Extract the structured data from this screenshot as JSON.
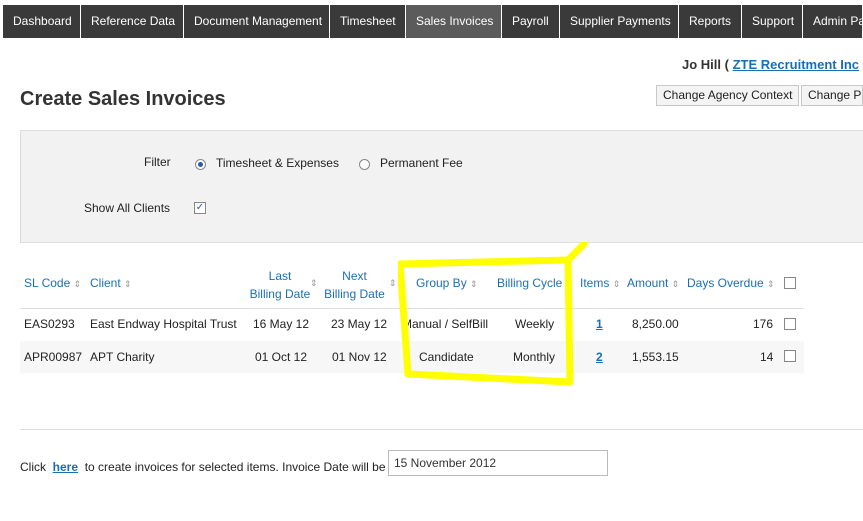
{
  "nav": [
    "Dashboard",
    "Reference Data",
    "Document Management",
    "Timesheet",
    "Sales Invoices",
    "Payroll",
    "Supplier Payments",
    "Reports",
    "Support",
    "Admin Pa"
  ],
  "user": {
    "name": "Jo Hill (",
    "agency": "ZTE Recruitment Inc"
  },
  "page_title": "Create Sales Invoices",
  "buttons": {
    "change_agency": "Change Agency Context",
    "change_pa": "Change Pa"
  },
  "filter": {
    "label": "Filter",
    "option1": "Timesheet & Expenses",
    "option2": "Permanent Fee",
    "show_all_label": "Show All Clients"
  },
  "table": {
    "headers": {
      "sl_code": "SL Code",
      "client": "Client",
      "last_billing_1": "Last",
      "last_billing_2": "Billing Date",
      "next_billing_1": "Next",
      "next_billing_2": "Billing Date",
      "group_by": "Group By",
      "billing_cycle": "Billing Cycle",
      "items": "Items",
      "amount": "Amount",
      "days_overdue": "Days Overdue"
    },
    "rows": [
      {
        "sl_code": "EAS0293",
        "client": "East Endway Hospital Trust",
        "last": "16 May 12",
        "next": "23 May 12",
        "group_by": "Manual / SelfBill",
        "cycle": "Weekly",
        "items": "1",
        "amount": "8,250.00",
        "overdue": "176"
      },
      {
        "sl_code": "APR00987",
        "client": "APT Charity",
        "last": "01 Oct 12",
        "next": "01 Nov 12",
        "group_by": "Candidate",
        "cycle": "Monthly",
        "items": "2",
        "amount": "1,553.15",
        "overdue": "14"
      }
    ]
  },
  "footer": {
    "prefix": "Click",
    "link": "here",
    "suffix": "to create invoices for selected items. Invoice Date will be",
    "invoice_date": "15 November 2012"
  },
  "colors": {
    "nav_bg": "#3a3a3a",
    "link": "#1a6fb4",
    "highlight": "#ffff00"
  }
}
